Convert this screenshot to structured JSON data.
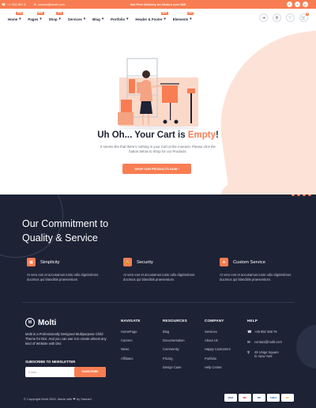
{
  "topbar": {
    "phone": "+1 234 567 8",
    "email": "contact@molti.com",
    "promo": "Get Free Delivery on Orders over $60",
    "social": [
      "f",
      "t",
      "p"
    ]
  },
  "nav": {
    "items": [
      {
        "label": "Home",
        "badge": "NEW"
      },
      {
        "label": "Pages",
        "badge": "NEW"
      },
      {
        "label": "Shop",
        "badge": "HOT"
      },
      {
        "label": "Services",
        "badge": ""
      },
      {
        "label": "Blog",
        "badge": ""
      },
      {
        "label": "Portfolio",
        "badge": ""
      },
      {
        "label": "Header & Footer",
        "badge": "NEW"
      },
      {
        "label": "Elements",
        "badge": "HOT"
      }
    ],
    "cart_count": "0"
  },
  "cart": {
    "title_start": "Uh Oh... Your Cart is ",
    "title_accent": "Empty",
    "title_end": "!",
    "description_line1": "It seems like that there's nothing in your Cart at the moment. Please click the",
    "description_line2": "button below to Shop for our Products.",
    "button": "SHOP OUR PRODUCTS NOW"
  },
  "commitment": {
    "line1": "Our Commitment to",
    "line2": "Quality & Service"
  },
  "features": [
    {
      "title": "Simplicity",
      "text": "At vero eos et accusamus iusto odio dignissimos ducimus qui blanditiis praesentium."
    },
    {
      "title": "Security",
      "text": "At vero eos et accusamus iusto odio dignissimos ducimus qui blanditiis praesentium."
    },
    {
      "title": "Custom Service",
      "text": "At vero eos et accusamus iusto odio dignissimos ducimus qui blanditiis praesentium."
    }
  ],
  "footer": {
    "brand": "Molti",
    "about": "Molti is a Professionally Designed Multipurpose Child Theme for Divi. And you can use it to create almost any kind of Website with Divi.",
    "subscribe_title": "SUBSCRIBE TO NEWSLETTER",
    "email_placeholder": "Email",
    "subscribe_button": "SUBSCRIBE",
    "columns": {
      "navigate": {
        "title": "NAVIGATE",
        "links": [
          "HomePage",
          "Careers",
          "News",
          "Affiliates"
        ]
      },
      "resources": {
        "title": "RESOURCES",
        "links": [
          "Blog",
          "Documentation",
          "Community",
          "Pricing",
          "Design Case"
        ]
      },
      "company": {
        "title": "COMPANY",
        "links": [
          "Services",
          "About Us",
          "Happy Customers",
          "Portfolio",
          "Help Center"
        ]
      },
      "help": {
        "title": "HELP",
        "phone": "+49 892 358 75",
        "email": "contact@molti.com",
        "address": "49 Unige Square D. New York"
      }
    },
    "copyright": "© Copyright Molti 2020. Made with ❤ by Samar2.",
    "payments": [
      "VISA",
      "MC",
      "PP",
      "AMEX",
      "MC"
    ]
  },
  "colors": {
    "accent": "#f97d52",
    "dark": "#1d2235",
    "blob": "#fde3d7"
  }
}
